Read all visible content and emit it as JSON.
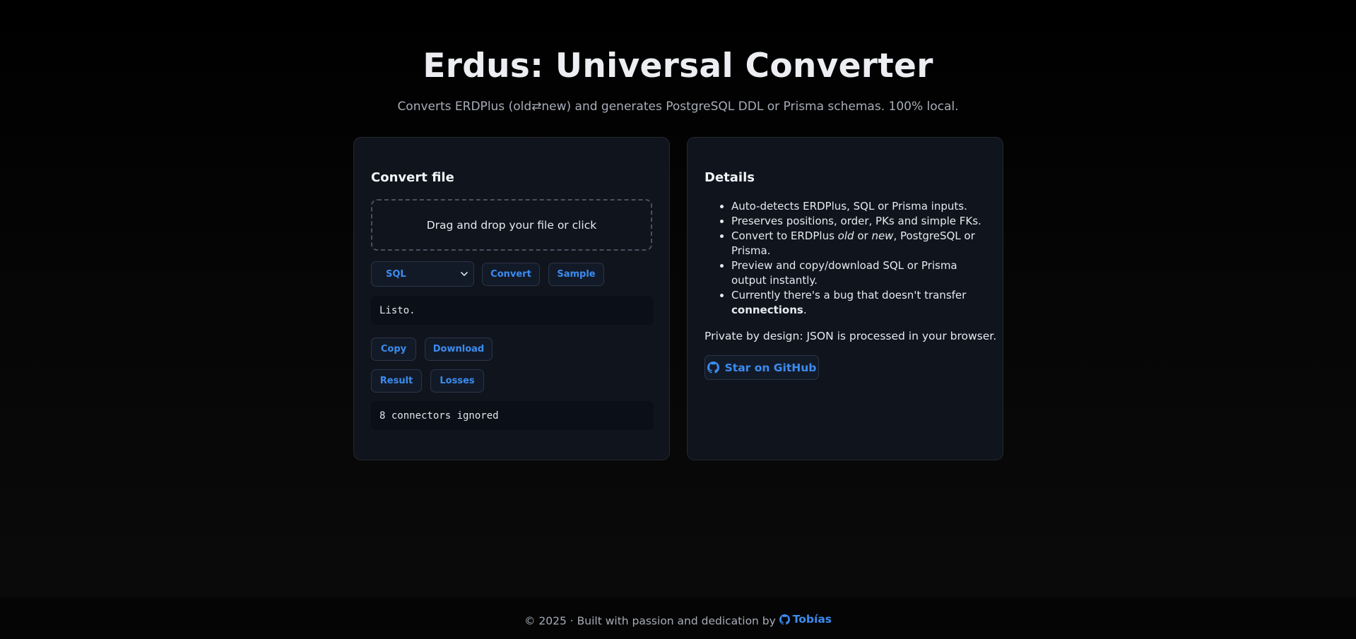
{
  "header": {
    "title": "Erdus: Universal Converter",
    "subtitle": "Converts ERDPlus (old⇄new) and generates PostgreSQL DDL or Prisma schemas. 100% local."
  },
  "convert_card": {
    "heading": "Convert file",
    "dropzone_text": "Drag and drop your file or click",
    "format_select": "SQL",
    "convert_label": "Convert",
    "sample_label": "Sample",
    "status_text": "Listo.",
    "copy_label": "Copy",
    "download_label": "Download",
    "result_label": "Result",
    "losses_label": "Losses",
    "losses_text": "8 connectors ignored"
  },
  "details_card": {
    "heading": "Details",
    "items": {
      "i0": "Auto-detects ERDPlus, SQL or Prisma inputs.",
      "i1": "Preserves positions, order, PKs and simple FKs.",
      "i2_a": "Convert to ERDPlus ",
      "i2_old": "old",
      "i2_b": " or ",
      "i2_new": "new",
      "i2_c": ", PostgreSQL or Prisma.",
      "i3": "Preview and copy/download SQL or Prisma output instantly.",
      "i4_a": "Currently there's a bug that doesn't transfer ",
      "i4_bold": "connections",
      "i4_c": "."
    },
    "private_text": "Private by design: JSON is processed in your browser.",
    "github_label": "Star on GitHub"
  },
  "footer": {
    "text": "© 2025 · Built with passion and dedication by ",
    "author": "Tobías"
  },
  "colors": {
    "accent": "#3b8cf0",
    "card_bg": "#10141d",
    "page_bg": "#000000"
  },
  "icons": [
    "github-icon",
    "chevron-down-icon"
  ]
}
